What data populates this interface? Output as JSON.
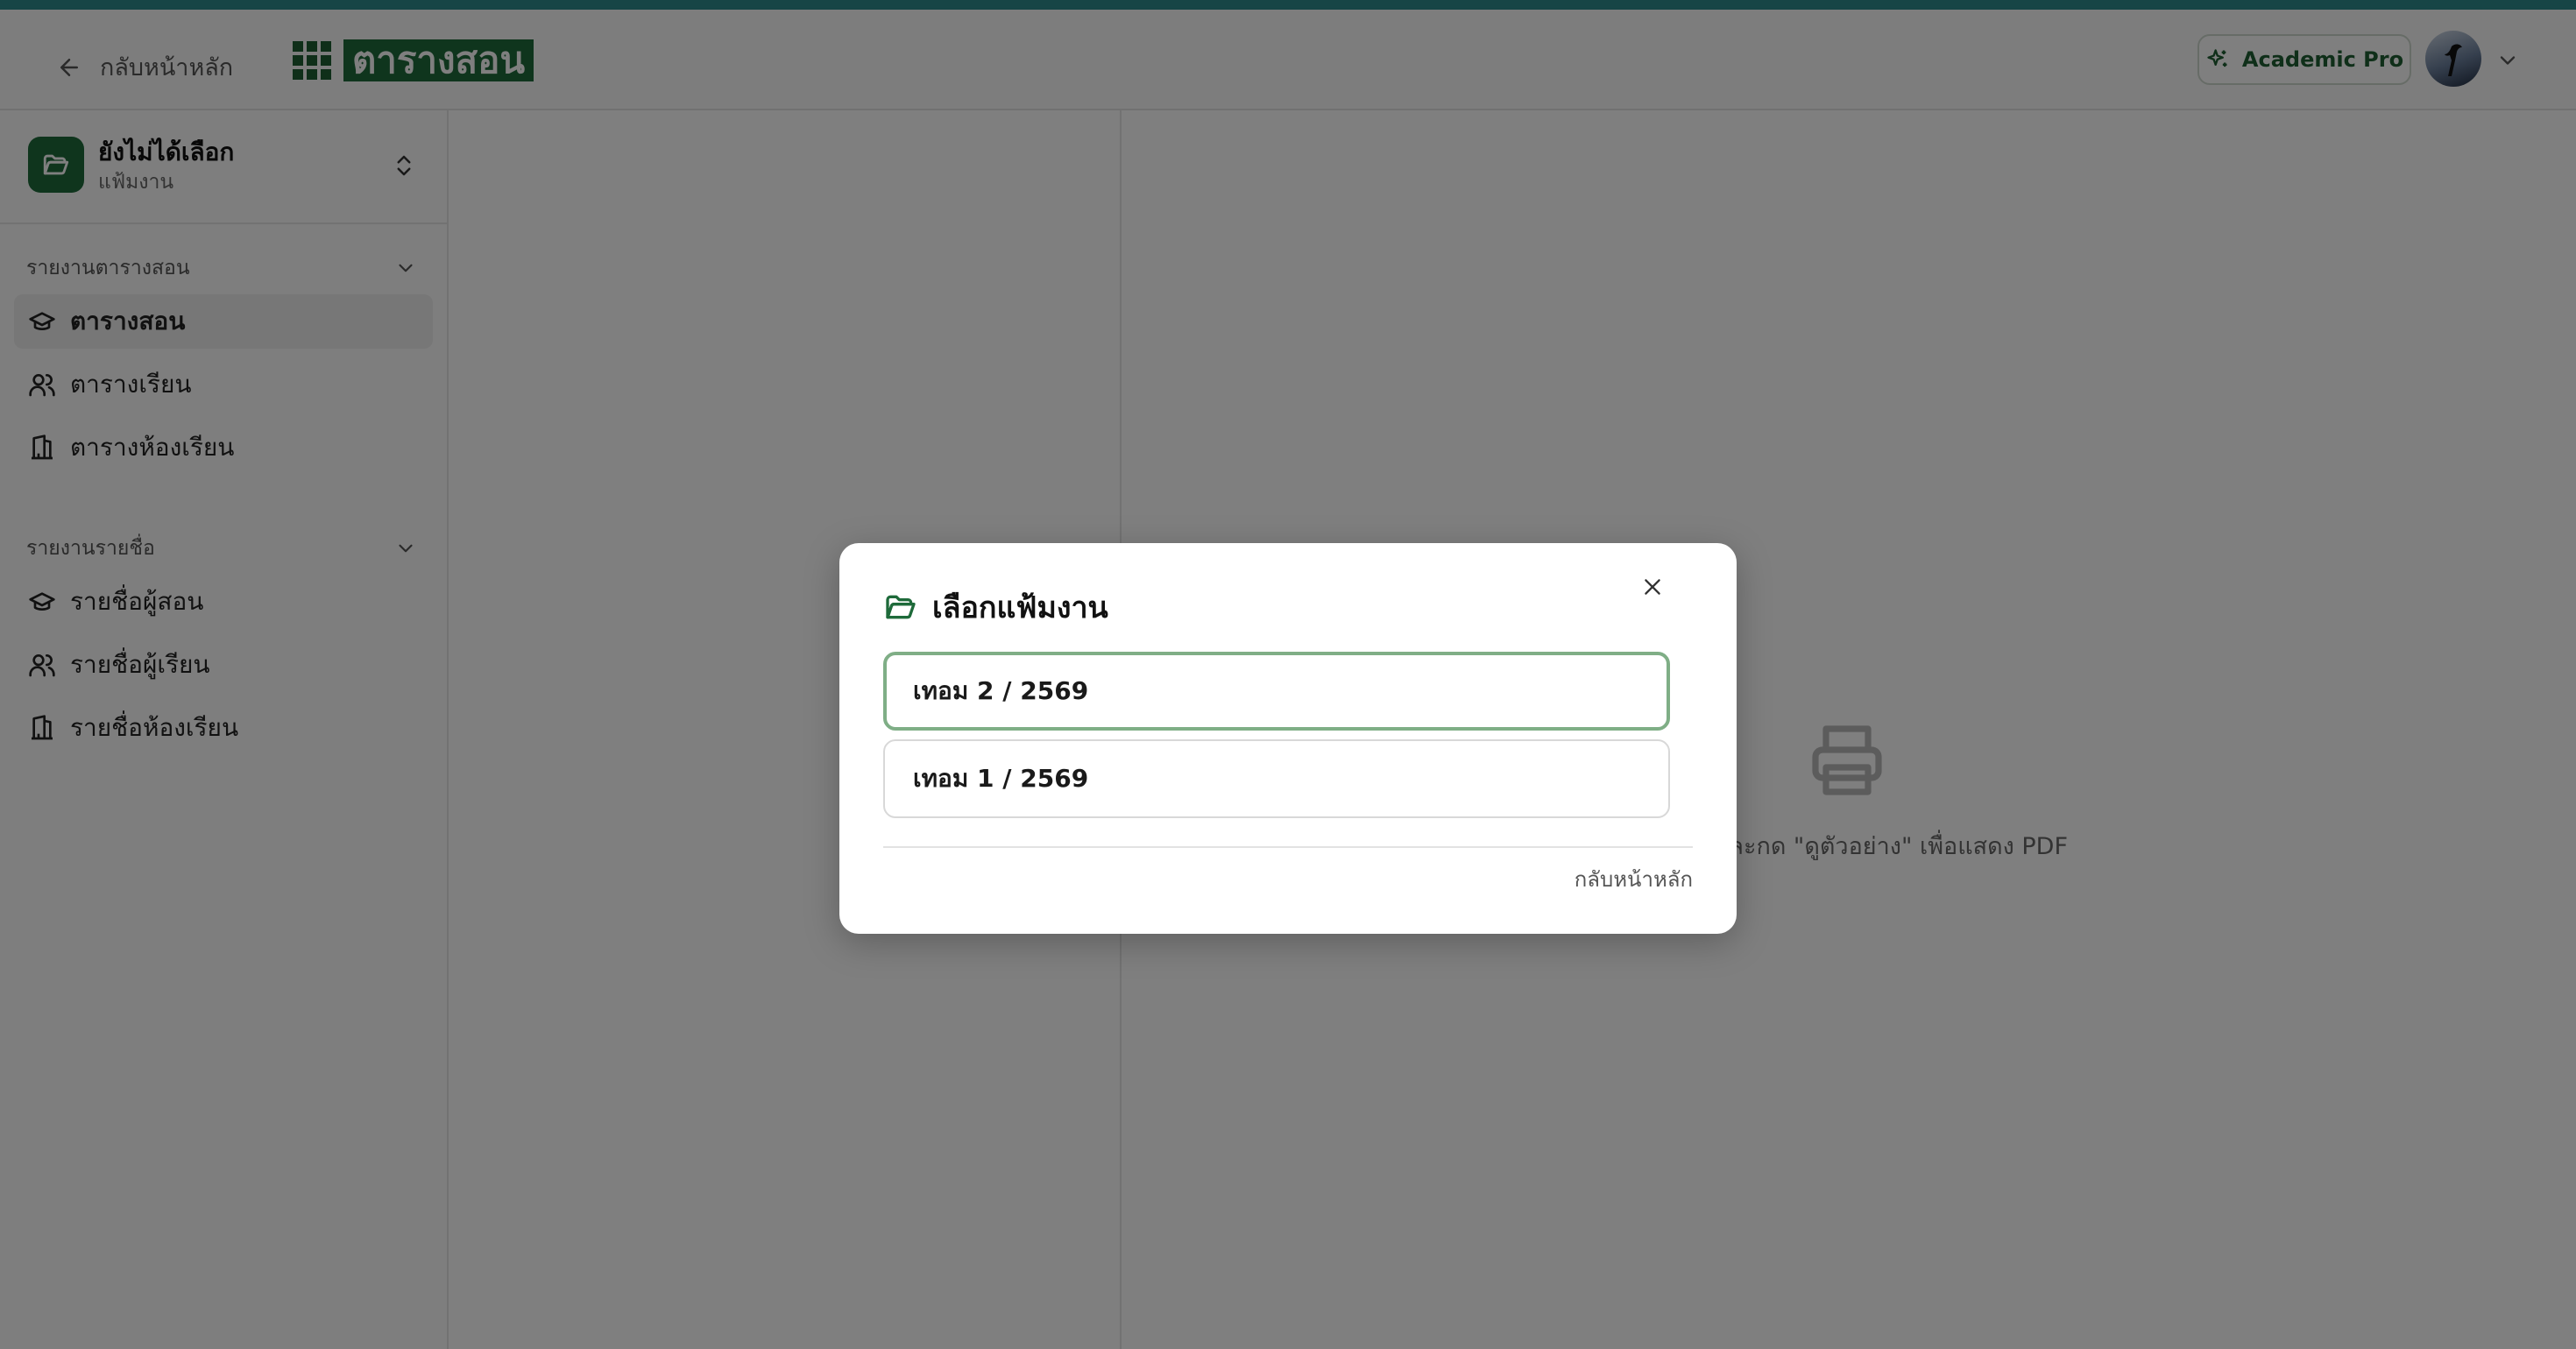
{
  "header": {
    "back_label": "กลับหน้าหลัก",
    "logo_text": "ตารางสอน",
    "plan_badge": "Academic Pro",
    "accent_color": "#2f8a8c",
    "brand_color": "#1e6a3a"
  },
  "sidebar": {
    "workspace": {
      "title": "ยังไม่ได้เลือก",
      "subtitle": "แฟ้มงาน"
    },
    "sections": [
      {
        "heading": "รายงานตารางสอน",
        "items": [
          {
            "label": "ตารางสอน",
            "icon": "graduation-cap-icon",
            "active": true
          },
          {
            "label": "ตารางเรียน",
            "icon": "users-icon",
            "active": false
          },
          {
            "label": "ตารางห้องเรียน",
            "icon": "building-icon",
            "active": false
          }
        ]
      },
      {
        "heading": "รายงานรายชื่อ",
        "items": [
          {
            "label": "รายชื่อผู้สอน",
            "icon": "graduation-cap-icon",
            "active": false
          },
          {
            "label": "รายชื่อผู้เรียน",
            "icon": "users-icon",
            "active": false
          },
          {
            "label": "รายชื่อห้องเรียน",
            "icon": "building-icon",
            "active": false
          }
        ]
      }
    ]
  },
  "preview": {
    "hint": "และกด \"ดูตัวอย่าง\" เพื่อแสดง PDF",
    "icon": "printer-icon"
  },
  "modal": {
    "title": "เลือกแฟ้มงาน",
    "options": [
      {
        "label": "เทอม 2 / 2569",
        "selected": true
      },
      {
        "label": "เทอม 1 / 2569",
        "selected": false
      }
    ],
    "back_link": "กลับหน้าหลัก"
  }
}
